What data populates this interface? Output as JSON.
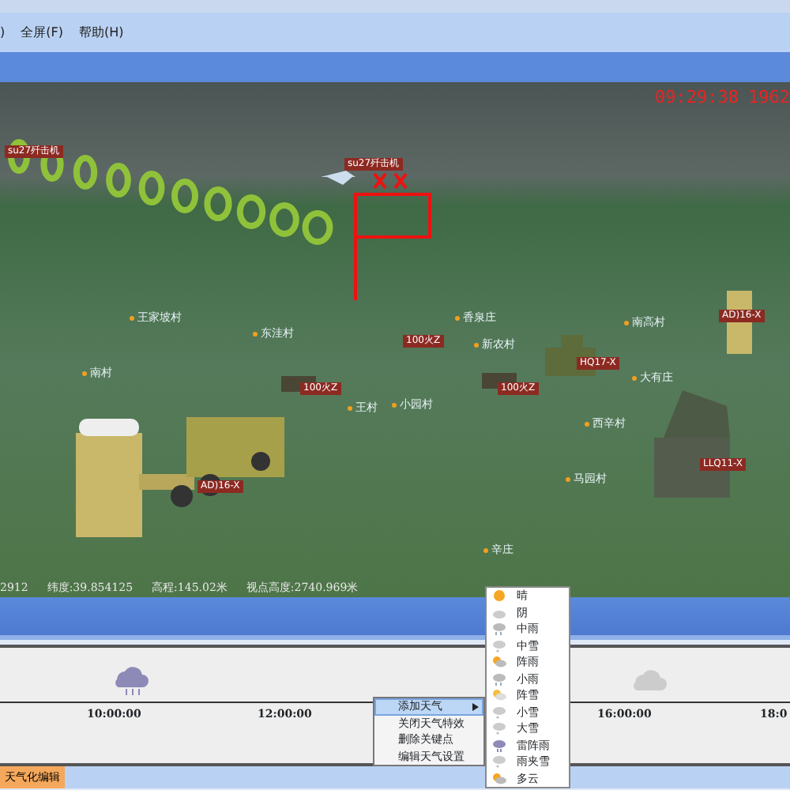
{
  "menu_bar": [
    ")",
    "全屏(F)",
    "帮助(H)"
  ],
  "clock": [
    "09:29:38",
    "1962"
  ],
  "scene": {
    "labels": [
      {
        "text": "su27歼击机",
        "kind": "unit"
      },
      {
        "text": "su27歼击机",
        "kind": "unit"
      },
      {
        "text": "100火Z",
        "kind": "unit"
      },
      {
        "text": "100火Z",
        "kind": "unit"
      },
      {
        "text": "100火Z",
        "kind": "unit"
      },
      {
        "text": "HQ17-X",
        "kind": "unit"
      },
      {
        "text": "AD)16-X",
        "kind": "unit"
      },
      {
        "text": "AD)16-X",
        "kind": "unit"
      },
      {
        "text": "LLQ11-X",
        "kind": "unit"
      },
      {
        "text": "王家坡村",
        "kind": "place"
      },
      {
        "text": "东洼村",
        "kind": "place"
      },
      {
        "text": "南村",
        "kind": "place"
      },
      {
        "text": "香泉庄",
        "kind": "place"
      },
      {
        "text": "新农村",
        "kind": "place"
      },
      {
        "text": "南高村",
        "kind": "place"
      },
      {
        "text": "大有庄",
        "kind": "place"
      },
      {
        "text": "王村",
        "kind": "place"
      },
      {
        "text": "小园村",
        "kind": "place"
      },
      {
        "text": "西辛村",
        "kind": "place"
      },
      {
        "text": "马园村",
        "kind": "place"
      },
      {
        "text": "辛庄",
        "kind": "place"
      }
    ]
  },
  "status": [
    "2912",
    "纬度:39.854125",
    "高程:145.02米",
    "视点高度:2740.969米"
  ],
  "timeline": {
    "ticks": [
      "10:00:00",
      "12:00:00",
      "16:00:00",
      "18:0"
    ],
    "markers": [
      {
        "kind": "thunderstorm"
      },
      {
        "kind": "cloud"
      }
    ]
  },
  "context_menu": [
    {
      "label": "添加天气",
      "selected": true,
      "submenu": true
    },
    {
      "label": "关闭天气特效",
      "selected": false,
      "submenu": false
    },
    {
      "label": "删除关键点",
      "selected": false,
      "submenu": false
    },
    {
      "label": "编辑天气设置",
      "selected": false,
      "submenu": false
    }
  ],
  "weather_menu": [
    {
      "label": "晴",
      "kind": "sun"
    },
    {
      "label": "阴",
      "kind": "cloud"
    },
    {
      "label": "中雨",
      "kind": "rain"
    },
    {
      "label": "中雪",
      "kind": "snow"
    },
    {
      "label": "阵雨",
      "kind": "sunrain"
    },
    {
      "label": "小雨",
      "kind": "rain"
    },
    {
      "label": "阵雪",
      "kind": "sunsnow"
    },
    {
      "label": "小雪",
      "kind": "snow"
    },
    {
      "label": "大雪",
      "kind": "snow"
    },
    {
      "label": "雷阵雨",
      "kind": "storm"
    },
    {
      "label": "雨夹雪",
      "kind": "snow"
    },
    {
      "label": "多云",
      "kind": "sunrain"
    }
  ],
  "bottom_tabs": [
    {
      "label": "天气化编辑",
      "selected": true
    }
  ]
}
